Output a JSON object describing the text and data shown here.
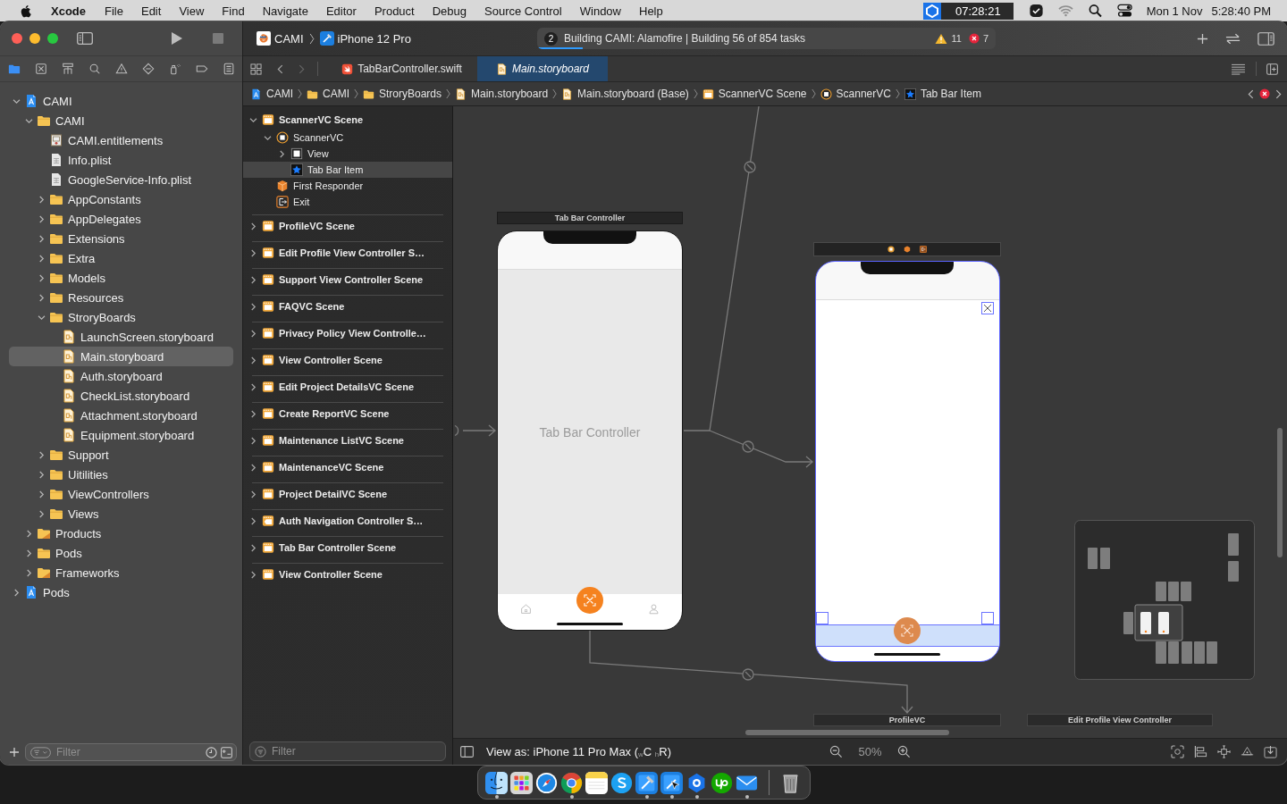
{
  "menu_bar": {
    "app_name": "Xcode",
    "menus": [
      "File",
      "Edit",
      "View",
      "Find",
      "Navigate",
      "Editor",
      "Product",
      "Debug",
      "Source Control",
      "Window",
      "Help"
    ],
    "timer": "07:28:21",
    "date": "Mon 1 Nov",
    "time": "5:28:40 PM"
  },
  "toolbar": {
    "scheme": "CAMI",
    "destination": "iPhone 12 Pro",
    "activity": {
      "task_count": "2",
      "message": "Building CAMI: Alamofire | Building 56 of 854 tasks",
      "level": 0.1,
      "warnings": "11",
      "errors": "7"
    }
  },
  "navigator": {
    "tabs": [
      {
        "selected": true
      },
      {
        "selected": false
      },
      {
        "selected": false
      },
      {
        "selected": false
      },
      {
        "selected": false
      },
      {
        "selected": false
      },
      {
        "selected": false
      },
      {
        "selected": false
      },
      {
        "selected": false
      }
    ],
    "tree": [
      {
        "label": "CAMI",
        "kind": "project",
        "expanded": true,
        "selected": false,
        "children": [
          {
            "label": "CAMI",
            "kind": "folder",
            "expanded": true,
            "selected": false,
            "children": [
              {
                "label": "CAMI.entitlements",
                "kind": "entitlements",
                "selected": false
              },
              {
                "label": "Info.plist",
                "kind": "plist",
                "selected": false
              },
              {
                "label": "GoogleService-Info.plist",
                "kind": "plist",
                "selected": false
              },
              {
                "label": "AppConstants",
                "kind": "folder",
                "expanded": false,
                "selected": false
              },
              {
                "label": "AppDelegates",
                "kind": "folder",
                "expanded": false,
                "selected": false
              },
              {
                "label": "Extensions",
                "kind": "folder",
                "expanded": false,
                "selected": false
              },
              {
                "label": "Extra",
                "kind": "folder",
                "expanded": false,
                "selected": false
              },
              {
                "label": "Models",
                "kind": "folder",
                "expanded": false,
                "selected": false
              },
              {
                "label": "Resources",
                "kind": "folder",
                "expanded": false,
                "selected": false
              },
              {
                "label": "StroryBoards",
                "kind": "folder",
                "expanded": true,
                "selected": false,
                "children": [
                  {
                    "label": "LaunchScreen.storyboard",
                    "kind": "storyboard",
                    "selected": false
                  },
                  {
                    "label": "Main.storyboard",
                    "kind": "storyboard",
                    "selected": true
                  },
                  {
                    "label": "Auth.storyboard",
                    "kind": "storyboard",
                    "selected": false
                  },
                  {
                    "label": "CheckList.storyboard",
                    "kind": "storyboard",
                    "selected": false
                  },
                  {
                    "label": "Attachment.storyboard",
                    "kind": "storyboard",
                    "selected": false
                  },
                  {
                    "label": "Equipment.storyboard",
                    "kind": "storyboard",
                    "selected": false
                  }
                ]
              },
              {
                "label": "Support",
                "kind": "folder",
                "expanded": false,
                "selected": false
              },
              {
                "label": "Uitilities",
                "kind": "folder",
                "expanded": false,
                "selected": false
              },
              {
                "label": "ViewControllers",
                "kind": "folder",
                "expanded": false,
                "selected": false
              },
              {
                "label": "Views",
                "kind": "folder",
                "expanded": false,
                "selected": false
              }
            ]
          },
          {
            "label": "Products",
            "kind": "special_folder",
            "expanded": false,
            "selected": false
          },
          {
            "label": "Pods",
            "kind": "folder",
            "expanded": false,
            "selected": false
          },
          {
            "label": "Frameworks",
            "kind": "special_folder",
            "expanded": false,
            "selected": false
          }
        ]
      },
      {
        "label": "Pods",
        "kind": "project",
        "expanded": false,
        "selected": false
      }
    ],
    "filter": {
      "placeholder": "Filter"
    }
  },
  "editor": {
    "tabs": [
      {
        "label": "TabBarController.swift",
        "kind": "swift",
        "selected": false,
        "preview": false
      },
      {
        "label": "Main.storyboard",
        "kind": "storyboard",
        "selected": true,
        "preview": true
      }
    ],
    "jump_bar": [
      {
        "label": "CAMI",
        "kind": "project"
      },
      {
        "label": "CAMI",
        "kind": "folder"
      },
      {
        "label": "StroryBoards",
        "kind": "folder"
      },
      {
        "label": "Main.storyboard",
        "kind": "storyboard"
      },
      {
        "label": "Main.storyboard (Base)",
        "kind": "storyboard"
      },
      {
        "label": "ScannerVC Scene",
        "kind": "scene"
      },
      {
        "label": "ScannerVC",
        "kind": "controller"
      },
      {
        "label": "Tab Bar Item",
        "kind": "tab_bar_item"
      }
    ]
  },
  "outline": {
    "items": [
      {
        "label": "ScannerVC Scene",
        "kind": "scene",
        "expanded": true,
        "selected": false,
        "children": [
          {
            "label": "ScannerVC",
            "kind": "controller",
            "expanded": true,
            "selected": false,
            "children": [
              {
                "label": "View",
                "kind": "view",
                "expanded": false,
                "selected": false
              },
              {
                "label": "Tab Bar Item",
                "kind": "tab_bar_item",
                "selected": true
              }
            ]
          },
          {
            "label": "First Responder",
            "kind": "first_responder",
            "selected": false
          },
          {
            "label": "Exit",
            "kind": "exit",
            "selected": false
          }
        ]
      },
      {
        "label": "ProfileVC Scene",
        "kind": "scene",
        "expanded": false,
        "selected": false
      },
      {
        "label": "Edit Profile View Controller S…",
        "kind": "scene",
        "expanded": false,
        "selected": false
      },
      {
        "label": "Support View Controller Scene",
        "kind": "scene",
        "expanded": false,
        "selected": false
      },
      {
        "label": "FAQVC Scene",
        "kind": "scene",
        "expanded": false,
        "selected": false
      },
      {
        "label": "Privacy Policy View Controlle…",
        "kind": "scene",
        "expanded": false,
        "selected": false
      },
      {
        "label": "View Controller Scene",
        "kind": "scene",
        "expanded": false,
        "selected": false
      },
      {
        "label": "Edit Project DetailsVC Scene",
        "kind": "scene",
        "expanded": false,
        "selected": false
      },
      {
        "label": "Create ReportVC Scene",
        "kind": "scene",
        "expanded": false,
        "selected": false
      },
      {
        "label": "Maintenance ListVC Scene",
        "kind": "scene",
        "expanded": false,
        "selected": false
      },
      {
        "label": "MaintenanceVC Scene",
        "kind": "scene",
        "expanded": false,
        "selected": false
      },
      {
        "label": "Project DetailVC Scene",
        "kind": "scene",
        "expanded": false,
        "selected": false
      },
      {
        "label": "Auth Navigation Controller S…",
        "kind": "navigation_scene",
        "expanded": false,
        "selected": false
      },
      {
        "label": "Tab Bar Controller Scene",
        "kind": "scene",
        "expanded": false,
        "selected": false
      },
      {
        "label": "View Controller Scene",
        "kind": "scene",
        "expanded": false,
        "selected": false
      }
    ],
    "filter": {
      "placeholder": "Filter"
    }
  },
  "canvas": {
    "scenes": [
      {
        "kind": "tab_bar_controller",
        "title": "Tab Bar Controller",
        "label": "Tab Bar Controller",
        "selected": false
      },
      {
        "kind": "scanner",
        "selected": true
      },
      {
        "kind": "stub",
        "title": "ProfileVC"
      },
      {
        "kind": "stub",
        "title": "Edit Profile View Controller"
      }
    ],
    "view_as": "View as: iPhone 11 Pro Max ($_{w}$C $_{h}$R)",
    "zoom": "50%"
  },
  "dock": [
    {
      "running": true
    },
    {
      "running": false
    },
    {
      "running": false
    },
    {
      "running": true
    },
    {
      "running": false
    },
    {
      "running": false
    },
    {
      "running": true
    },
    {
      "running": true
    },
    {
      "running": true
    },
    {
      "running": false
    },
    {
      "running": true
    },
    {
      "running": false
    }
  ]
}
